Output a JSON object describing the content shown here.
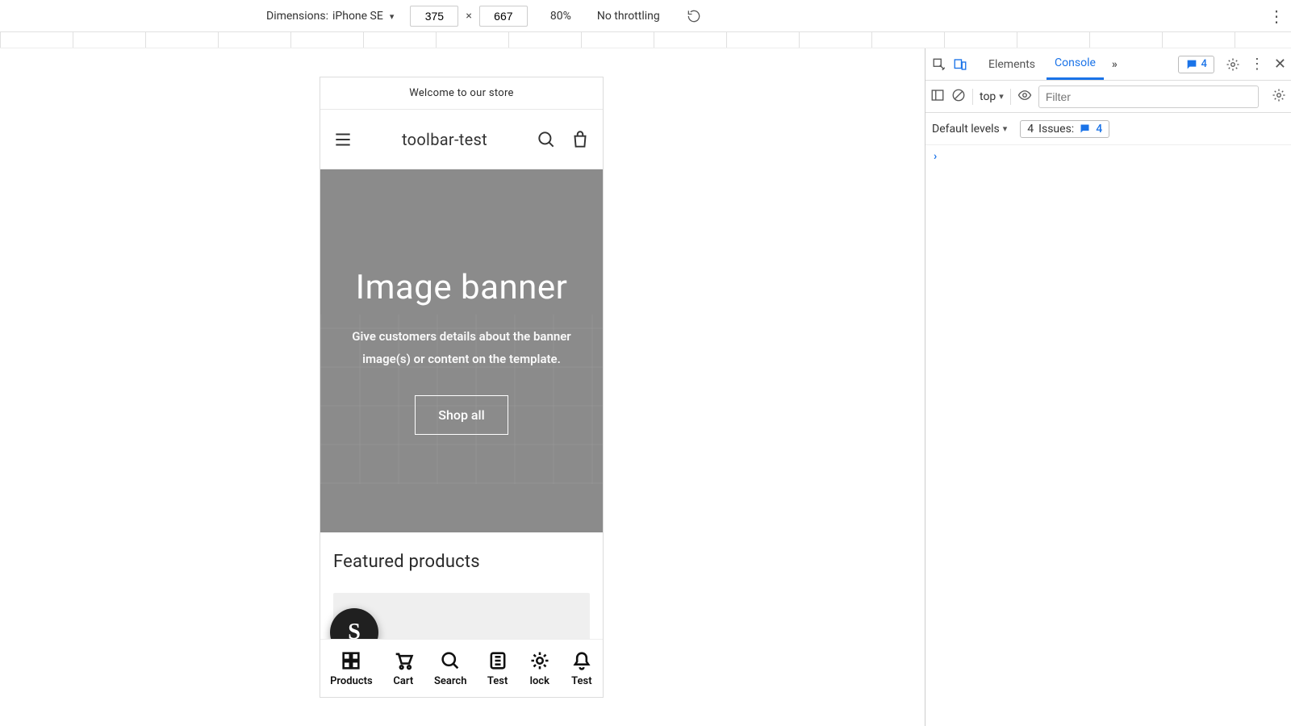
{
  "device_toolbar": {
    "dimensions_label": "Dimensions:",
    "device_name": "iPhone SE",
    "width": "375",
    "height": "667",
    "zoom": "80%",
    "throttling": "No throttling"
  },
  "phone": {
    "announcement": "Welcome to our store",
    "store_title": "toolbar-test",
    "banner_title": "Image banner",
    "banner_sub": "Give customers details about the banner image(s) or content on the template.",
    "banner_button": "Shop all",
    "featured_title": "Featured products",
    "toolbar": {
      "items": [
        {
          "label": "Products"
        },
        {
          "label": "Cart"
        },
        {
          "label": "Search"
        },
        {
          "label": "Test"
        },
        {
          "label": "lock"
        },
        {
          "label": "Test"
        }
      ]
    }
  },
  "devtools": {
    "tab_elements": "Elements",
    "tab_console": "Console",
    "badge_count": "4",
    "context": "top",
    "filter_placeholder": "Filter",
    "levels_label": "Default levels",
    "issues_label_prefix": "Issues:",
    "issues_count_prefix": "4",
    "issues_count_badge": "4",
    "prompt": "›"
  }
}
